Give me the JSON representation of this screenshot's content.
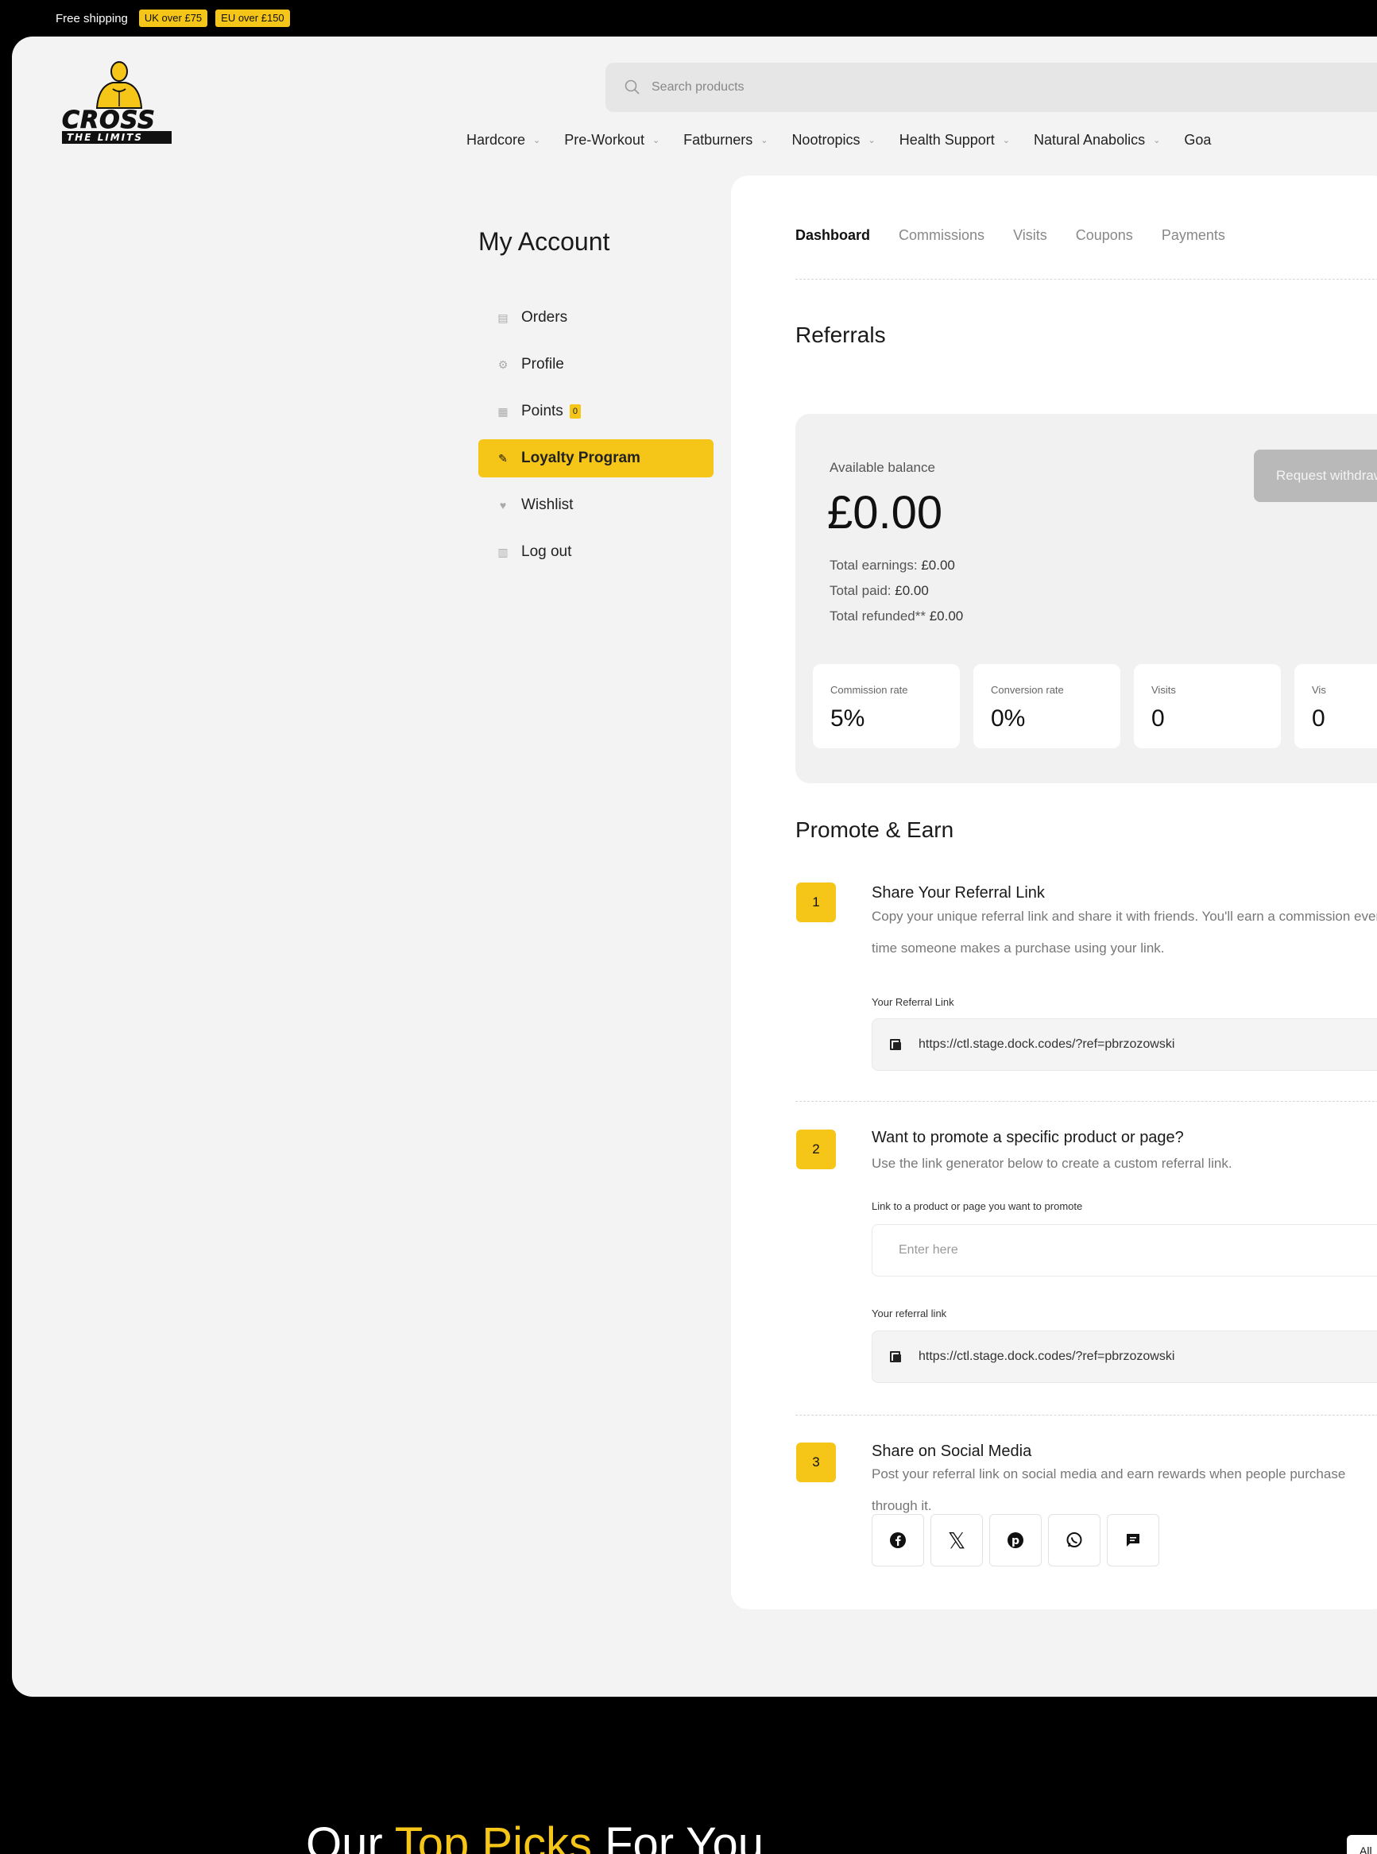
{
  "topbar": {
    "shipping": "Free shipping",
    "badges": [
      "UK over £75",
      "EU over £150"
    ]
  },
  "logo": {
    "line1": "CROSS",
    "line2": "THE LIMITS"
  },
  "search": {
    "placeholder": "Search products"
  },
  "nav": [
    "Hardcore",
    "Pre-Workout",
    "Fatburners",
    "Nootropics",
    "Health Support",
    "Natural Anabolics",
    "Goa"
  ],
  "sidebar": {
    "title": "My Account",
    "items": [
      {
        "label": "Orders",
        "icon": "list-icon"
      },
      {
        "label": "Profile",
        "icon": "gear-icon"
      },
      {
        "label": "Points",
        "icon": "gift-icon",
        "badge": "0"
      },
      {
        "label": "Loyalty Program",
        "icon": "megaphone-icon",
        "active": true
      },
      {
        "label": "Wishlist",
        "icon": "heart-icon"
      },
      {
        "label": "Log out",
        "icon": "lock-icon"
      }
    ]
  },
  "tabs": [
    "Dashboard",
    "Commissions",
    "Visits",
    "Coupons",
    "Payments"
  ],
  "referrals": {
    "title": "Referrals",
    "available_label": "Available balance",
    "amount": "£0.00",
    "request_button": "Request withdrawal",
    "total_earnings_label": "Total earnings:",
    "total_earnings": "£0.00",
    "total_paid_label": "Total paid:",
    "total_paid": "£0.00",
    "total_refunded_label": "Total refunded**",
    "total_refunded": "£0.00",
    "stats": [
      {
        "label": "Commission rate",
        "value": "5%"
      },
      {
        "label": "Conversion rate",
        "value": "0%"
      },
      {
        "label": "Visits",
        "value": "0"
      },
      {
        "label": "Vis",
        "value": "0"
      }
    ]
  },
  "promote": {
    "title": "Promote & Earn",
    "step1": {
      "num": "1",
      "title": "Share Your Referral Link",
      "desc": "Copy your unique referral link and share it with friends. You'll earn a commission every time someone makes a purchase using your link.",
      "field_label": "Your Referral Link",
      "link": "https://ctl.stage.dock.codes/?ref=pbrzozowski"
    },
    "step2": {
      "num": "2",
      "title": "Want to promote a specific product or page?",
      "desc": "Use the link generator below to create a custom referral link.",
      "input_label": "Link to a product or page you want to promote",
      "input_placeholder": "Enter here",
      "result_label": "Your referral link",
      "link": "https://ctl.stage.dock.codes/?ref=pbrzozowski"
    },
    "step3": {
      "num": "3",
      "title": "Share on Social Media",
      "desc": "Post your referral link on social media and earn rewards when people purchase through it.",
      "socials": [
        "facebook-icon",
        "x-icon",
        "pinterest-icon",
        "whatsapp-icon",
        "message-icon"
      ]
    }
  },
  "bottom": {
    "picks_a": "Our ",
    "picks_b": "Top Picks",
    "picks_c": " For You",
    "all_button": "All"
  }
}
